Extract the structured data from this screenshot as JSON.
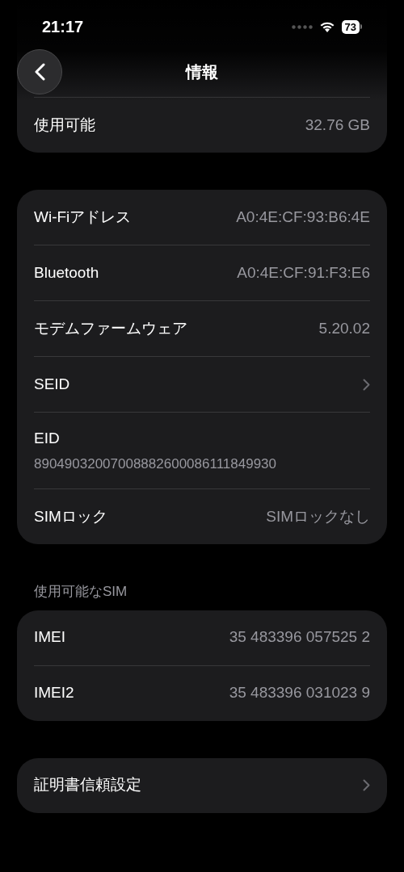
{
  "status_bar": {
    "time": "21:17",
    "battery": "73"
  },
  "nav": {
    "title": "情報"
  },
  "groups": [
    {
      "rows": [
        {
          "kind": "value",
          "label": "使用可能",
          "value": "32.76 GB"
        }
      ]
    },
    {
      "rows": [
        {
          "kind": "value",
          "label": "Wi-Fiアドレス",
          "value": "A0:4E:CF:93:B6:4E"
        },
        {
          "kind": "value",
          "label": "Bluetooth",
          "value": "A0:4E:CF:91:F3:E6"
        },
        {
          "kind": "value",
          "label": "モデムファームウェア",
          "value": "5.20.02"
        },
        {
          "kind": "link",
          "label": "SEID"
        },
        {
          "kind": "stacked",
          "label": "EID",
          "value": "89049032007008882600086111849930"
        },
        {
          "kind": "value",
          "label": "SIMロック",
          "value": "SIMロックなし"
        }
      ]
    },
    {
      "header": "使用可能なSIM",
      "rows": [
        {
          "kind": "value",
          "label": "IMEI",
          "value": "35 483396 057525 2"
        },
        {
          "kind": "value",
          "label": "IMEI2",
          "value": "35 483396 031023 9"
        }
      ]
    },
    {
      "rows": [
        {
          "kind": "link",
          "label": "証明書信頼設定"
        }
      ]
    }
  ]
}
